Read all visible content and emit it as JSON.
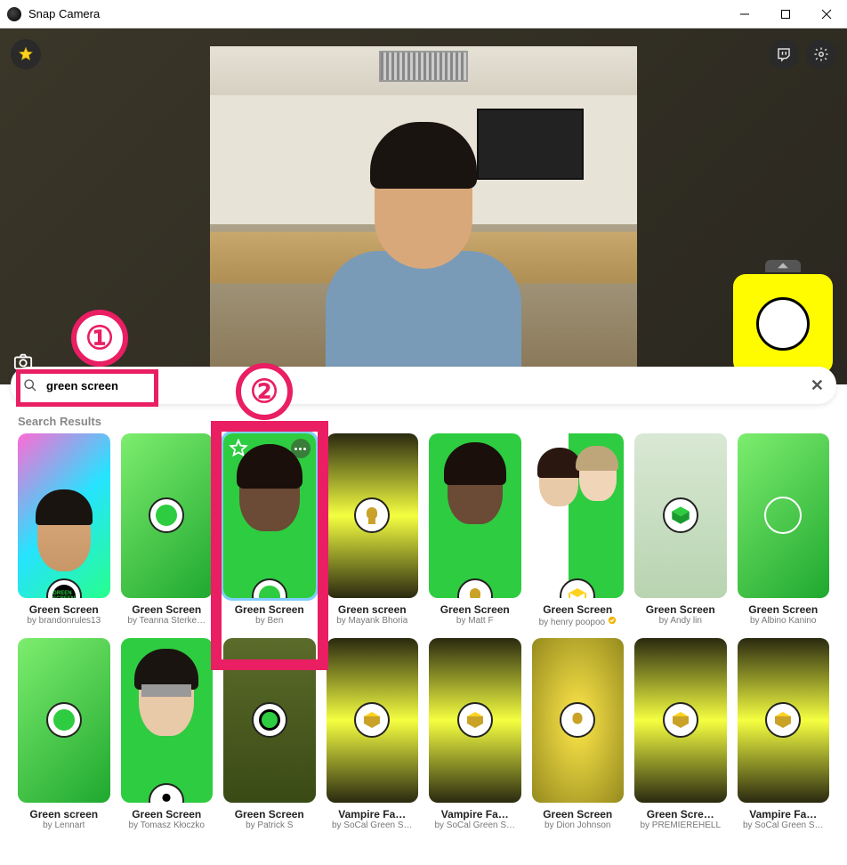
{
  "window": {
    "title": "Snap Camera"
  },
  "search": {
    "value": "green screen",
    "results_header": "Search Results"
  },
  "annotations": {
    "one": "①",
    "two": "②"
  },
  "lenses": [
    {
      "title": "Green Screen",
      "author": "by brandonrules13"
    },
    {
      "title": "Green Screen",
      "author": "by Teanna Sterke…"
    },
    {
      "title": "Green Screen",
      "author": "by Ben"
    },
    {
      "title": "Green screen",
      "author": "by Mayank Bhoria"
    },
    {
      "title": "Green Screen",
      "author": "by Matt F"
    },
    {
      "title": "Green Screen",
      "author": "by henry poopoo",
      "verified": true
    },
    {
      "title": "Green Screen",
      "author": "by Andy lin"
    },
    {
      "title": "Green Screen",
      "author": "by Albino Kanino"
    },
    {
      "title": "Green screen",
      "author": "by Lennart"
    },
    {
      "title": "Green Screen",
      "author": "by Tomasz Kłoczko"
    },
    {
      "title": "Green Screen",
      "author": "by Patrick S"
    },
    {
      "title": "Vampire Fa…",
      "author": "by SoCal Green S…"
    },
    {
      "title": "Vampire Fa…",
      "author": "by SoCal Green S…"
    },
    {
      "title": "Green Screen",
      "author": "by Dion Johnson"
    },
    {
      "title": "Green Scre…",
      "author": "by PREMIEREHELL"
    },
    {
      "title": "Vampire Fa…",
      "author": "by SoCal Green S…"
    }
  ]
}
